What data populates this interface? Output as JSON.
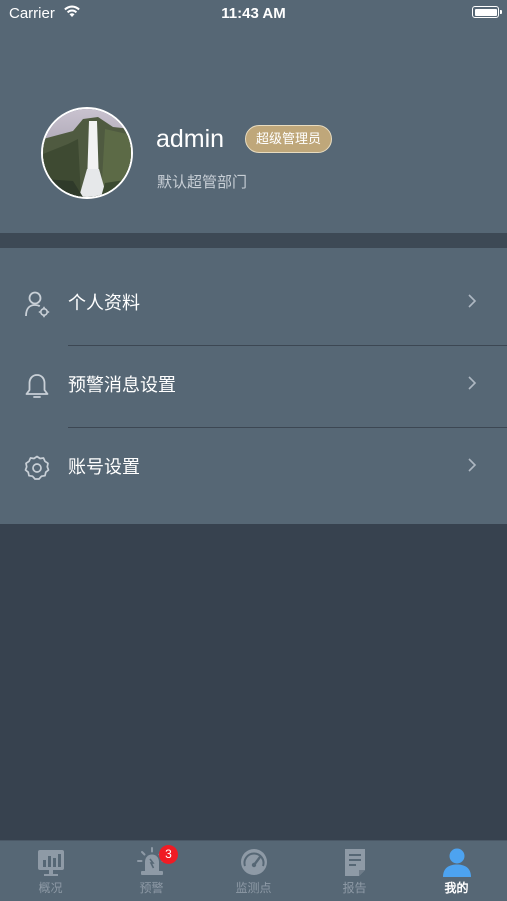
{
  "status_bar": {
    "carrier": "Carrier",
    "time": "11:43 AM"
  },
  "profile": {
    "username": "admin",
    "role": "超级管理员",
    "department": "默认超管部门"
  },
  "menu": [
    {
      "label": "个人资料",
      "icon": "user-settings-icon"
    },
    {
      "label": "预警消息设置",
      "icon": "bell-icon"
    },
    {
      "label": "账号设置",
      "icon": "gear-icon"
    }
  ],
  "tabbar": [
    {
      "label": "概况",
      "icon": "chart-icon"
    },
    {
      "label": "预警",
      "icon": "alarm-icon",
      "badge": "3"
    },
    {
      "label": "监测点",
      "icon": "gauge-icon"
    },
    {
      "label": "报告",
      "icon": "report-icon"
    },
    {
      "label": "我的",
      "icon": "person-icon",
      "active": true
    }
  ],
  "colors": {
    "header_bg": "#566775",
    "page_bg": "#37424f",
    "badge_gold": "#bfa77a",
    "active_tab": "#4da3f0",
    "notification_red": "#f01b24"
  }
}
